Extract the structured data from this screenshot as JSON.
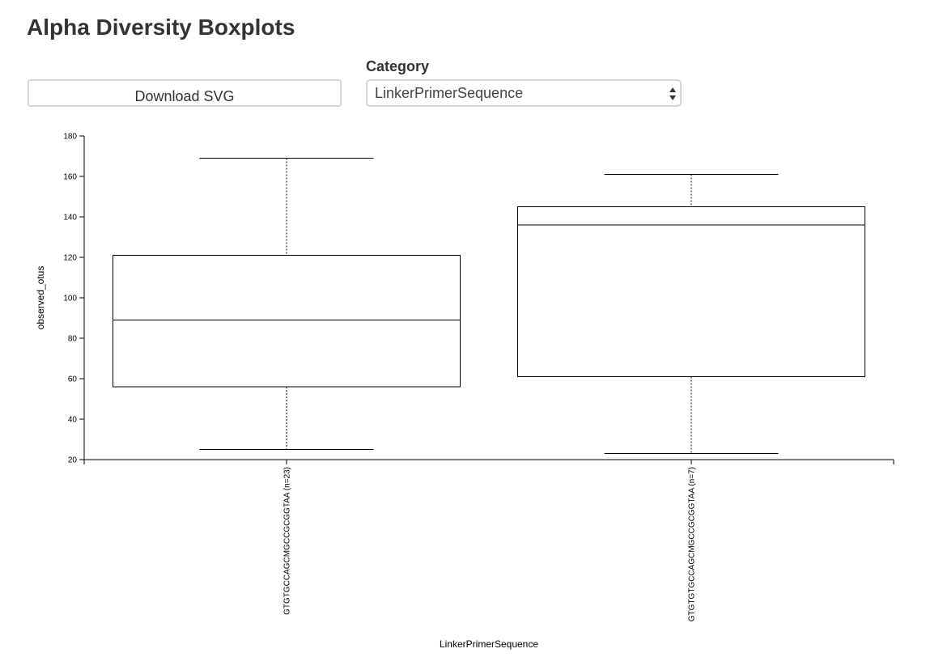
{
  "page": {
    "title": "Alpha Diversity Boxplots"
  },
  "controls": {
    "download_label": "Download SVG",
    "category_label": "Category",
    "category_selected": "LinkerPrimerSequence"
  },
  "chart_data": {
    "type": "boxplot",
    "xlabel": "LinkerPrimerSequence",
    "ylabel": "observed_otus",
    "ylim": [
      20,
      180
    ],
    "yticks": [
      20,
      40,
      60,
      80,
      100,
      120,
      140,
      160,
      180
    ],
    "grid": false,
    "categories": [
      "GTGTGCCAGCMGCCGCGGTAA (n=23)",
      "GTGTGTGCCAGCMGCCGCGGTAA (n=7)"
    ],
    "boxes": [
      {
        "whisker_low": 25,
        "q1": 56,
        "median": 89,
        "q3": 121,
        "whisker_high": 169
      },
      {
        "whisker_low": 23,
        "q1": 61,
        "median": 136,
        "q3": 145,
        "whisker_high": 161
      }
    ]
  }
}
